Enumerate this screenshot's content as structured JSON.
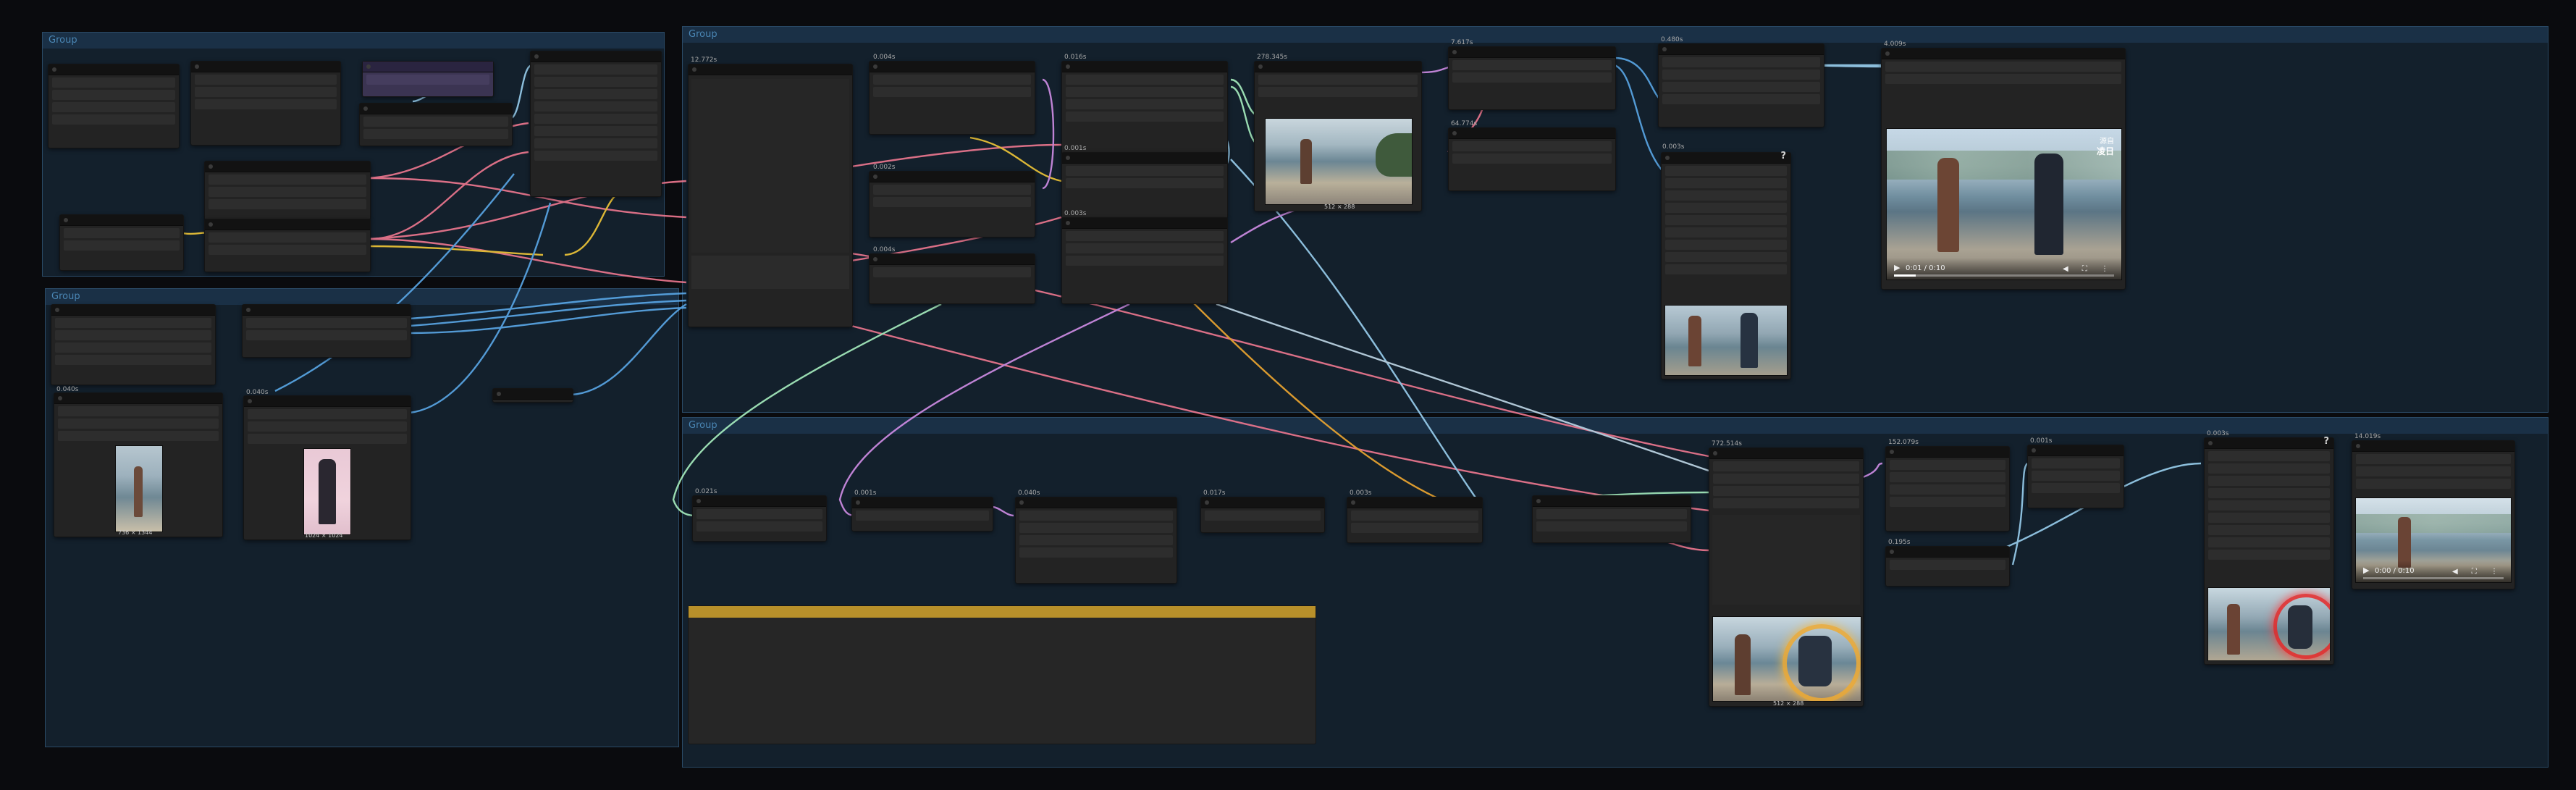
{
  "canvas": {
    "background": "#0a0b0e"
  },
  "groups": [
    {
      "id": "g1",
      "title": "Group"
    },
    {
      "id": "g2",
      "title": "Group"
    },
    {
      "id": "g3",
      "title": "Group"
    },
    {
      "id": "g4",
      "title": "Group"
    }
  ],
  "labels": {
    "n_a": "0.040s",
    "n_b": "0.040s",
    "n_main": "12.772s",
    "n_c1": "0.004s",
    "n_c2": "0.002s",
    "n_c3": "0.004s",
    "n_d1": "0.016s",
    "n_d2": "0.001s",
    "n_d3": "0.003s",
    "n_preview1": "278.345s",
    "n_e1": "7.617s",
    "n_e2": "64.774s",
    "n_f1": "0.480s",
    "n_f2": "0.003s",
    "n_vid1": "4.009s",
    "n_b1": "0.021s",
    "n_b2": "0.001s",
    "n_b3": "0.040s",
    "n_b4": "0.017s",
    "n_b5": "0.003s",
    "n_big2": "772.514s",
    "n_g1": "152.079s",
    "n_g2": "0.195s",
    "n_h1": "0.001s",
    "n_h2": "0.003s",
    "n_vid2": "14.019s"
  },
  "captions": {
    "img_left1": "736 × 1344",
    "img_left2": "1024 × 1024",
    "img_preview1": "512 × 288",
    "img_preview_big": "512 × 288"
  },
  "videos": {
    "top": {
      "time": "0:01 / 0:10",
      "progress": 0.1,
      "badge_right": "源自",
      "badge_right2": "凌日"
    },
    "bottom": {
      "time": "0:00 / 0:10",
      "progress": 0.0
    }
  },
  "question_marks": {
    "q1": "?",
    "q2": "?",
    "q3": "?"
  },
  "colors": {
    "wire_pink": "#f07890",
    "wire_yellow": "#f2c838",
    "wire_blue": "#5aa8e8",
    "wire_lightblue": "#9ad0f0",
    "wire_violet": "#d28ee8",
    "wire_mint": "#a8f0c0",
    "wire_orange": "#f0a830",
    "note_header": "#b8902a"
  }
}
